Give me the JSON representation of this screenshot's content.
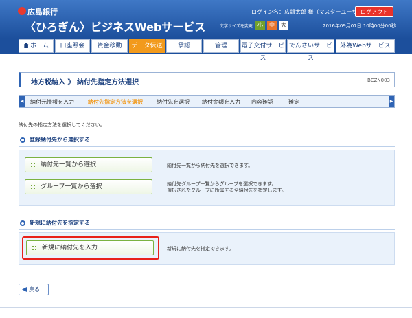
{
  "header": {
    "bank_name": "広島銀行",
    "service_name": "〈ひろぎん〉ビジネスWebサービス",
    "login_text": "ログイン名：広銀太郎 様（マスターユーザ）",
    "logout_label": "ログアウト",
    "font_size_label": "文字サイズを変更",
    "font_small": "小",
    "font_medium": "中",
    "font_large": "大",
    "datetime": "2016年09月07日 10時00分00秒"
  },
  "nav": {
    "tabs": [
      {
        "label": "ホーム"
      },
      {
        "label": "口座照会"
      },
      {
        "label": "資金移動"
      },
      {
        "label": "データ伝送"
      },
      {
        "label": "承認"
      },
      {
        "label": "管理"
      },
      {
        "label": "電子交付サービス"
      },
      {
        "label": "でんさいサービス"
      },
      {
        "label": "外為Webサービス"
      }
    ]
  },
  "page": {
    "title": "地方税納入 》 納付先指定方法選択",
    "screen_id": "BCZN003",
    "instruction": "納付先の指定方法を選択してください。"
  },
  "steps": [
    {
      "label": "納付元情報を入力"
    },
    {
      "label": "納付先指定方法を選択"
    },
    {
      "label": "納付先を選択"
    },
    {
      "label": "納付金額を入力"
    },
    {
      "label": "内容確認"
    },
    {
      "label": "確定"
    }
  ],
  "section_registered": {
    "heading": "登録納付先から選択する",
    "btn_list": "納付先一覧から選択",
    "desc_list": "納付先一覧から納付先を選択できます。",
    "btn_group": "グループ一覧から選択",
    "desc_group_1": "納付先グループ一覧からグループを選択できます。",
    "desc_group_2": "選択されたグループに所属する全納付先を指定します。"
  },
  "section_new": {
    "heading": "新規に納付先を指定する",
    "btn_new": "新規に納付先を入力",
    "desc_new": "新規に納付先を指定できます。"
  },
  "footer": {
    "back_label": "戻る"
  },
  "colors": {
    "header_blue": "#1c4f9c",
    "active_tab": "#f29a1c",
    "highlight_red": "#e8211a",
    "button_green": "#7bb241"
  }
}
